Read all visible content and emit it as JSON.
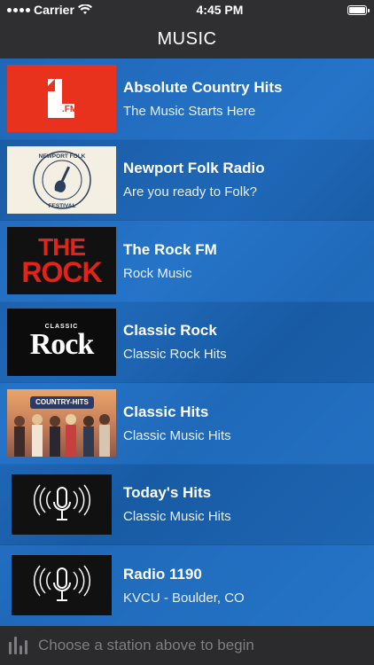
{
  "status": {
    "carrier": "Carrier",
    "time": "4:45 PM"
  },
  "nav": {
    "title": "MUSIC"
  },
  "stations": [
    {
      "name": "Absolute Country Hits",
      "desc": "The Music Starts Here",
      "logo_text": "1",
      "logo_sub": ".FM"
    },
    {
      "name": "Newport Folk Radio",
      "desc": "Are you ready to Folk?",
      "logo_text": "NEWPORT FOLK",
      "logo_sub": "FESTIVAL"
    },
    {
      "name": "The Rock FM",
      "desc": "Rock Music",
      "logo_text": "THE",
      "logo_sub": "ROCK"
    },
    {
      "name": "Classic Rock",
      "desc": "Classic Rock Hits",
      "logo_text": "CLASSIC",
      "logo_sub": "Rock"
    },
    {
      "name": "Classic Hits",
      "desc": "Classic Music Hits",
      "logo_text": "COUNTRY-HITS",
      "logo_sub": ""
    },
    {
      "name": "Today's Hits",
      "desc": "Classic Music Hits"
    },
    {
      "name": "Radio 1190",
      "desc": "KVCU - Boulder, CO"
    }
  ],
  "player": {
    "prompt": "Choose a station above to begin"
  },
  "icons": {
    "wifi": "wifi-icon",
    "battery": "battery-icon",
    "mic": "microphone-icon",
    "equalizer": "equalizer-icon"
  },
  "colors": {
    "accent": "#2472c4",
    "bar": "#2f2f31"
  }
}
